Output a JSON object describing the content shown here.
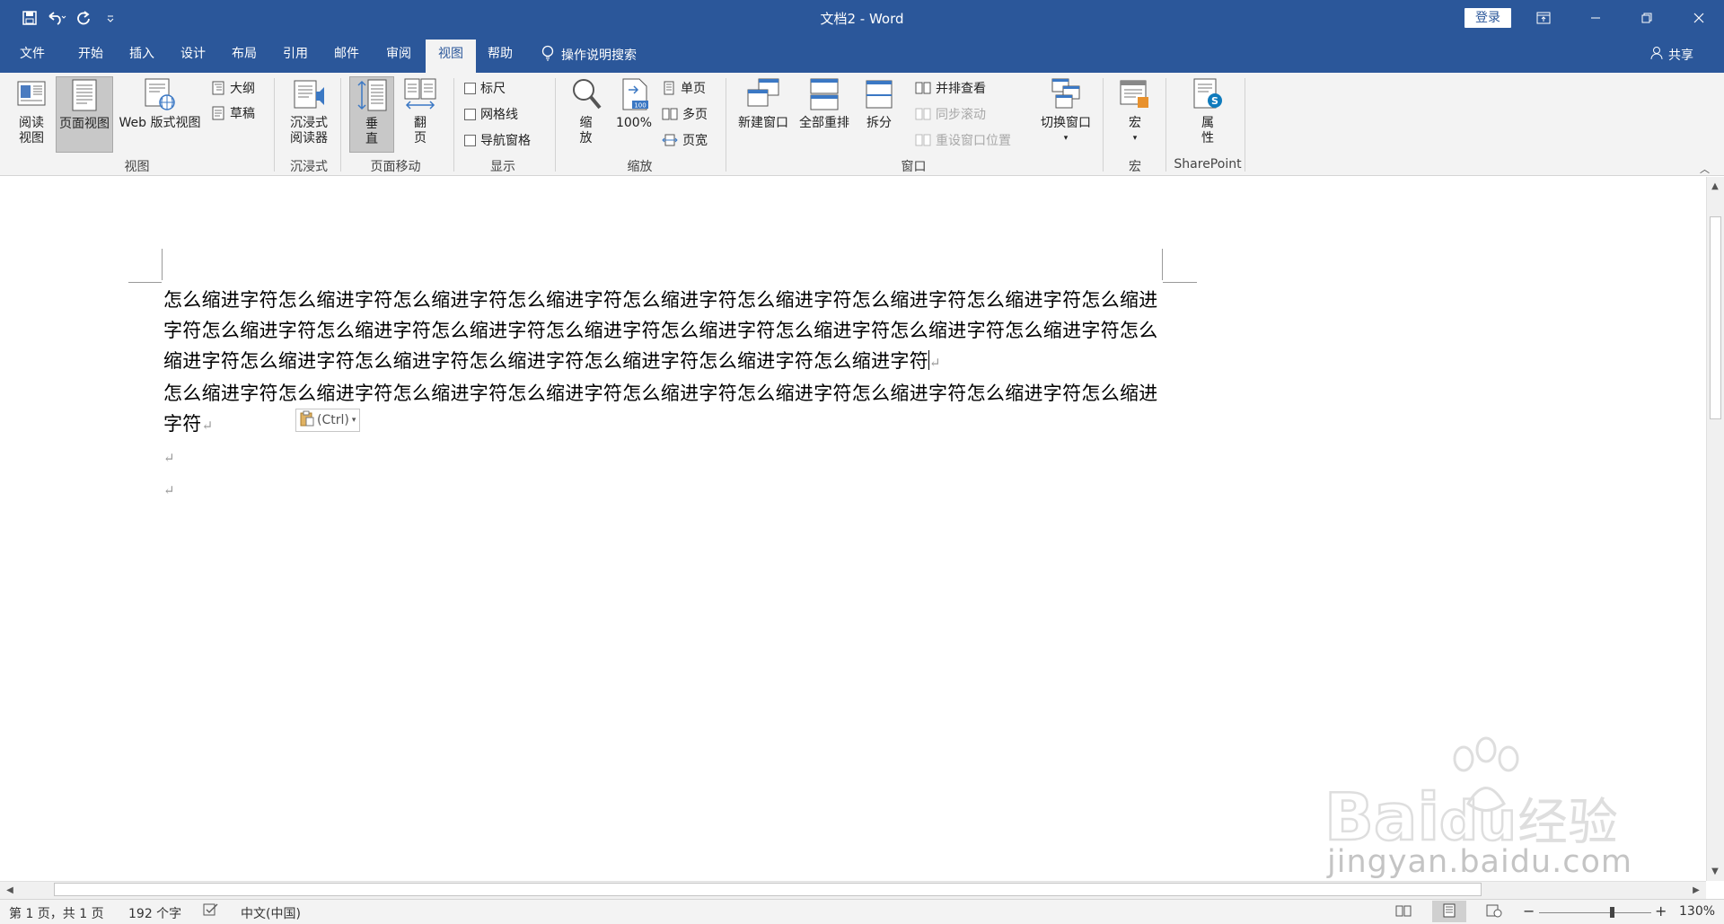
{
  "titlebar": {
    "doc_title": "文档2 - Word",
    "login": "登录"
  },
  "tabs": [
    {
      "label": "文件"
    },
    {
      "label": "开始"
    },
    {
      "label": "插入"
    },
    {
      "label": "设计"
    },
    {
      "label": "布局"
    },
    {
      "label": "引用"
    },
    {
      "label": "邮件"
    },
    {
      "label": "审阅"
    },
    {
      "label": "视图",
      "active": true
    },
    {
      "label": "帮助"
    }
  ],
  "tell_me": "操作说明搜索",
  "share": "共享",
  "ribbon": {
    "view": {
      "read_mode": "阅读\n视图",
      "print_layout": "页面视图",
      "web_layout": "Web 版式视图",
      "outline": "大纲",
      "draft": "草稿",
      "label": "视图"
    },
    "immersive": {
      "reader": "沉浸式\n阅读器",
      "label": "沉浸式"
    },
    "page_movement": {
      "vertical": "垂\n直",
      "side_to_side": "翻\n页",
      "label": "页面移动"
    },
    "show": {
      "ruler": "标尺",
      "gridlines": "网格线",
      "nav_pane": "导航窗格",
      "label": "显示"
    },
    "zoom": {
      "zoom": "缩\n放",
      "hundred": "100%",
      "one_page": "单页",
      "multi_page": "多页",
      "page_width": "页宽",
      "label": "缩放"
    },
    "window": {
      "new_window": "新建窗口",
      "arrange_all": "全部重排",
      "split": "拆分",
      "side_by_side": "并排查看",
      "sync_scroll": "同步滚动",
      "reset_pos": "重设窗口位置",
      "switch": "切换窗口",
      "label": "窗口"
    },
    "macros": {
      "macros": "宏",
      "label": "宏"
    },
    "sharepoint": {
      "properties": "属\n性",
      "label": "SharePoint"
    }
  },
  "document": {
    "para1": "怎么缩进字符怎么缩进字符怎么缩进字符怎么缩进字符怎么缩进字符怎么缩进字符怎么缩进字符怎么缩进字符怎么缩进字符怎么缩进字符怎么缩进字符怎么缩进字符怎么缩进字符怎么缩进字符怎么缩进字符怎么缩进字符怎么缩进字符怎么缩进字符怎么缩进字符怎么缩进字符怎么缩进字符怎么缩进字符怎么缩进字符怎么缩进字符",
    "para2_before": "怎么缩进字符",
    "para2_after": "怎么缩进字符怎么缩进字符怎么缩进字符怎么缩进字符怎么缩进字符怎么缩进字符怎么缩进字符怎么缩进字符",
    "paste_options": "(Ctrl)",
    "para_mark": "↵"
  },
  "status": {
    "page": "第 1 页，共 1 页",
    "words": "192 个字",
    "language": "中文(中国)",
    "zoom": "130%",
    "zoom_fraction": 0.65
  },
  "watermark": {
    "brand": "Bai du 经验",
    "url": "jingyan.baidu.com"
  },
  "colors": {
    "accent": "#2b579a",
    "ribbon_bg": "#f3f3f3"
  }
}
